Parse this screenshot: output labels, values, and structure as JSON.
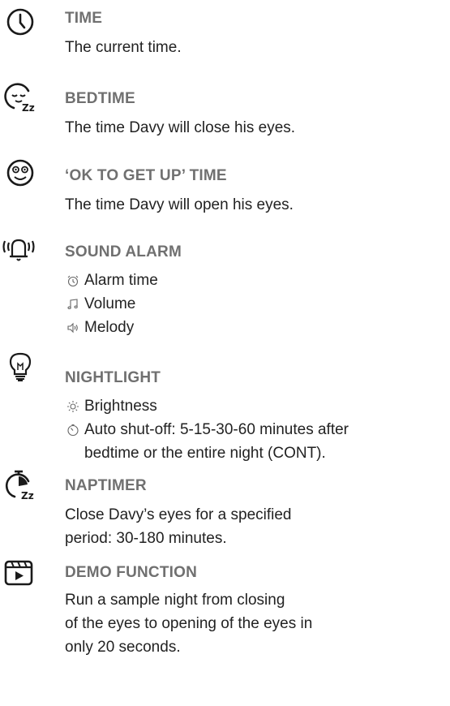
{
  "sections": [
    {
      "title": "TIME",
      "icon": "clock-icon",
      "lines": [
        "The current time."
      ]
    },
    {
      "title": "BEDTIME",
      "icon": "sleeping-face-icon",
      "lines": [
        "The time Davy will close his eyes."
      ]
    },
    {
      "title": "‘OK TO GET UP’ TIME",
      "icon": "awake-face-icon",
      "lines": [
        "The time Davy will open his eyes."
      ]
    },
    {
      "title": "SOUND ALARM",
      "icon": "ringing-bell-icon",
      "items": [
        {
          "icon": "alarm-clock-icon",
          "label": "Alarm time"
        },
        {
          "icon": "music-note-icon",
          "label": "Volume"
        },
        {
          "icon": "speaker-icon",
          "label": "Melody"
        }
      ]
    },
    {
      "title": "NIGHTLIGHT",
      "icon": "light-bulb-icon",
      "items": [
        {
          "icon": "sun-icon",
          "label": "Brightness"
        },
        {
          "icon": "timer-icon",
          "label": "Auto shut-off: 5-15-30-60 minutes after",
          "cont": "bedtime or the entire night (CONT)."
        }
      ]
    },
    {
      "title": "NAPTIMER",
      "icon": "stopwatch-zz-icon",
      "lines": [
        "Close Davy’s eyes for a specified",
        "period: 30-180 minutes."
      ]
    },
    {
      "title": "DEMO FUNCTION",
      "icon": "video-play-icon",
      "lines": [
        "Run a sample night from closing",
        "of the eyes to opening of the eyes in",
        "only 20 seconds."
      ]
    }
  ]
}
